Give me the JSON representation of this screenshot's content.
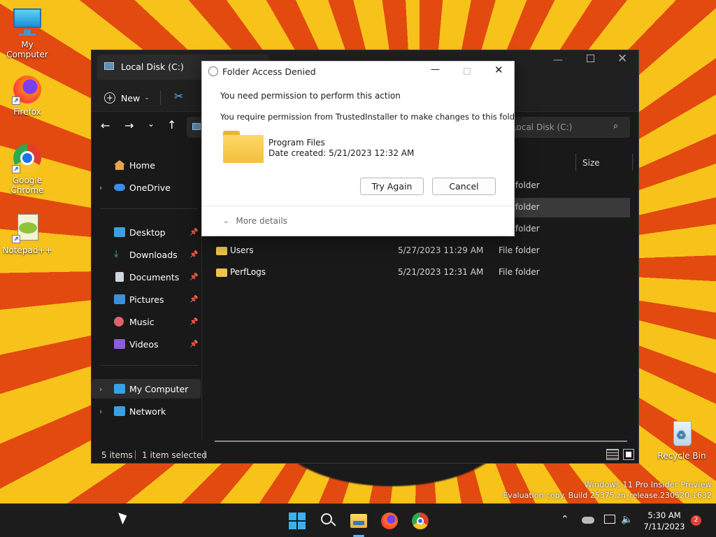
{
  "desktop": {
    "icons": [
      {
        "label": "My Computer"
      },
      {
        "label": "Firefox"
      },
      {
        "label": "Google Chrome"
      },
      {
        "label": "Notepad++"
      },
      {
        "label": "Recycle Bin"
      }
    ],
    "watermark": {
      "line1": "Windows 11 Pro Insider Preview",
      "line2": "Evaluation copy. Build 25375.zn_release.230520-1632"
    }
  },
  "explorer": {
    "title": "Local Disk (C:)",
    "toolbar": {
      "new_label": "New"
    },
    "search_placeholder": "Search Local Disk (C:)",
    "column_size": "Size",
    "sidebar": {
      "home": "Home",
      "onedrive": "OneDrive",
      "pinned": [
        {
          "label": "Desktop"
        },
        {
          "label": "Downloads"
        },
        {
          "label": "Documents"
        },
        {
          "label": "Pictures"
        },
        {
          "label": "Music"
        },
        {
          "label": "Videos"
        }
      ],
      "my_computer": "My Computer",
      "network": "Network"
    },
    "rows": [
      {
        "type": "folder"
      },
      {
        "type": "folder"
      },
      {
        "type": "folder"
      },
      {
        "name": "Users",
        "date": "5/27/2023 11:29 AM",
        "type": "File folder"
      },
      {
        "name": "PerfLogs",
        "date": "5/21/2023 12:31 AM",
        "type": "File folder"
      }
    ],
    "status": {
      "items": "5 items",
      "selected": "1 item selected"
    }
  },
  "dialog": {
    "title": "Folder Access Denied",
    "message1": "You need permission to perform this action",
    "message2": "You require permission from TrustedInstaller to make changes to this folder",
    "folder_name": "Program Files",
    "date_created": "Date created: 5/21/2023 12:32 AM",
    "try_again": "Try Again",
    "cancel": "Cancel",
    "more_details": "More details"
  },
  "taskbar": {
    "time": "5:30 AM",
    "date": "7/11/2023",
    "notification_count": "2"
  }
}
